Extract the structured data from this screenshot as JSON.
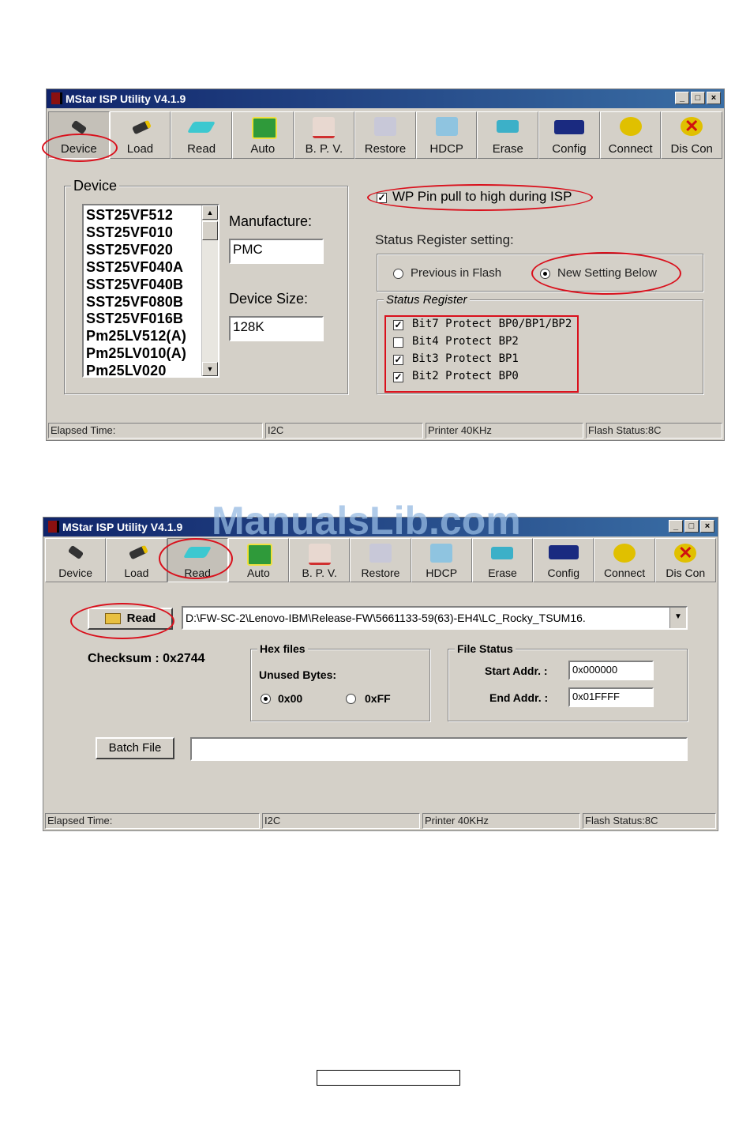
{
  "window1": {
    "title": "MStar ISP Utility V4.1.9",
    "toolbar": [
      "Device",
      "Load",
      "Read",
      "Auto",
      "B. P. V.",
      "Restore",
      "HDCP",
      "Erase",
      "Config",
      "Connect",
      "Dis Con"
    ],
    "device_group": {
      "legend": "Device",
      "list": [
        "SST25VF512",
        "SST25VF010",
        "SST25VF020",
        "SST25VF040A",
        "SST25VF040B",
        "SST25VF080B",
        "SST25VF016B",
        "Pm25LV512(A)",
        "Pm25LV010(A)",
        "Pm25LV020"
      ],
      "manufacture_label": "Manufacture:",
      "manufacture_value": "PMC",
      "device_size_label": "Device Size:",
      "device_size_value": "128K"
    },
    "wp_pin_label": "WP Pin pull to high during ISP",
    "wp_pin_checked": true,
    "status_register_setting_label": "Status Register setting:",
    "radio_previous": "Previous in Flash",
    "radio_new": "New Setting Below",
    "selected_option": "New Setting Below",
    "status_register_legend": "Status Register",
    "bits": [
      {
        "label": "Bit7 Protect BP0/BP1/BP2",
        "checked": true
      },
      {
        "label": "Bit4 Protect BP2",
        "checked": false
      },
      {
        "label": "Bit3 Protect BP1",
        "checked": true
      },
      {
        "label": "Bit2 Protect BP0",
        "checked": true
      }
    ],
    "status": [
      "Elapsed Time:",
      "I2C",
      "Printer  40KHz",
      "Flash Status:8C"
    ]
  },
  "window2": {
    "title": "MStar ISP Utility V4.1.9",
    "toolbar": [
      "Device",
      "Load",
      "Read",
      "Auto",
      "B. P. V.",
      "Restore",
      "HDCP",
      "Erase",
      "Config",
      "Connect",
      "Dis Con"
    ],
    "read_button": "Read",
    "file_path": "D:\\FW-SC-2\\Lenovo-IBM\\Release-FW\\5661133-59(63)-EH4\\LC_Rocky_TSUM16.",
    "checksum": "Checksum : 0x2744",
    "hex_files": {
      "legend": "Hex files",
      "unused_bytes_label": "Unused Bytes:",
      "option_00": "0x00",
      "option_ff": "0xFF",
      "selected": "0x00"
    },
    "file_status": {
      "legend": "File Status",
      "start_label": "Start Addr. :",
      "start_value": "0x000000",
      "end_label": "End Addr. :",
      "end_value": "0x01FFFF"
    },
    "batch_file_button": "Batch File",
    "batch_file_value": "",
    "status": [
      "Elapsed Time:",
      "I2C",
      "Printer  40KHz",
      "Flash Status:8C"
    ]
  },
  "watermark": "ManualsLib.com",
  "colors": {
    "highlight_red": "#d9101c",
    "window_gray": "#d4d0c8",
    "titlebar_blue": "#10246a"
  },
  "icons": [
    "device-chip-icon",
    "load-icon",
    "read-icon",
    "auto-icon",
    "bpv-icon",
    "restore-icon",
    "hdcp-icon",
    "erase-icon",
    "config-icon",
    "connect-icon",
    "disconnect-icon",
    "folder-open-icon"
  ]
}
